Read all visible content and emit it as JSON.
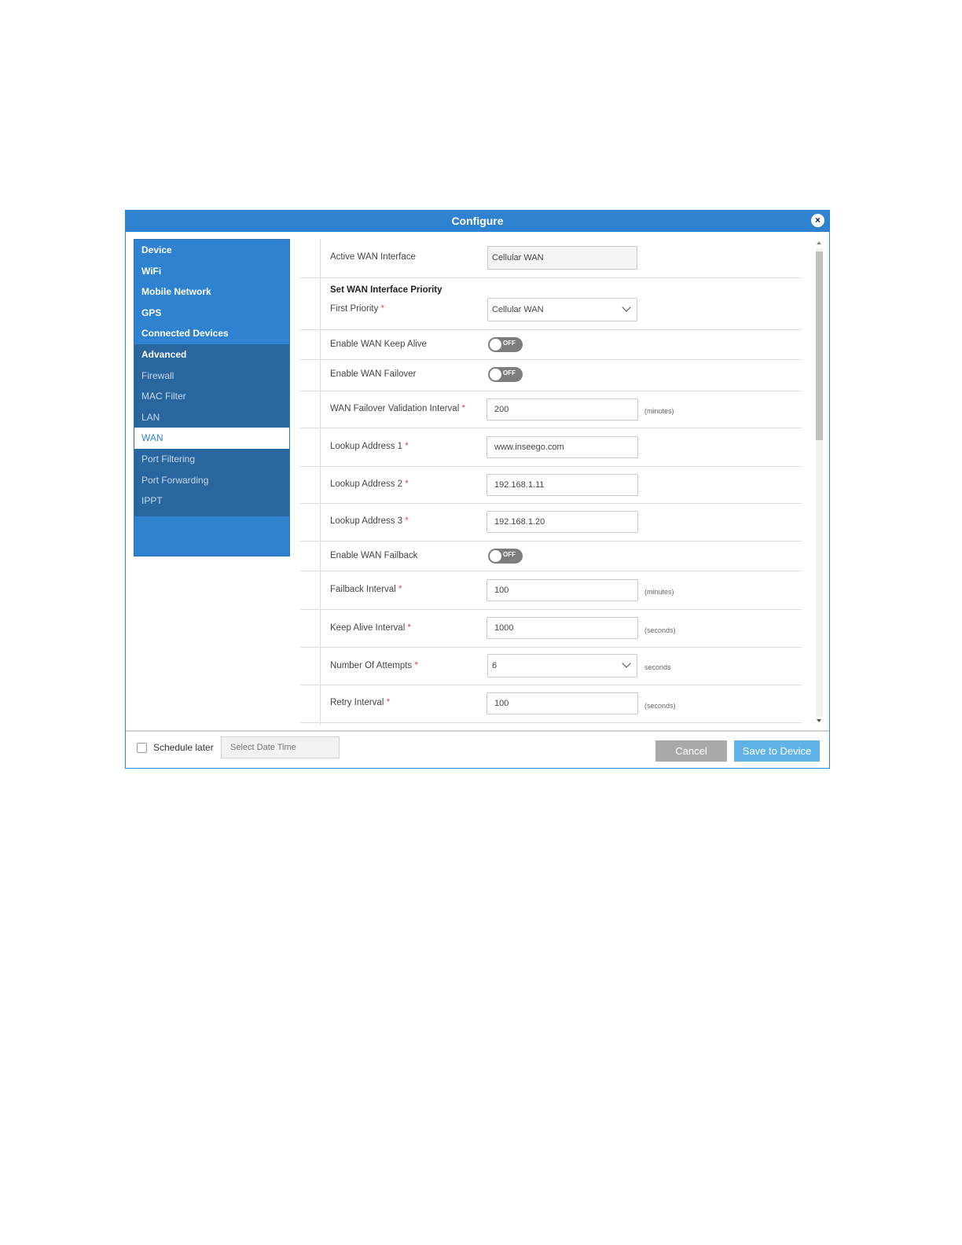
{
  "dialog": {
    "title": "Configure",
    "close_icon": "×"
  },
  "sidebar": {
    "items": [
      {
        "label": "Device"
      },
      {
        "label": "WiFi"
      },
      {
        "label": "Mobile Network"
      },
      {
        "label": "GPS"
      },
      {
        "label": "Connected Devices"
      },
      {
        "label": "Advanced"
      },
      {
        "label": "Firewall"
      },
      {
        "label": "MAC Filter"
      },
      {
        "label": "LAN"
      },
      {
        "label": "WAN",
        "selected": true
      },
      {
        "label": "Port Filtering"
      },
      {
        "label": "Port Forwarding"
      },
      {
        "label": "IPPT"
      }
    ]
  },
  "form": {
    "active_wan": {
      "label": "Active WAN Interface",
      "value": "Cellular WAN"
    },
    "priority": {
      "section": "Set WAN Interface Priority",
      "label": "First Priority",
      "value": "Cellular WAN"
    },
    "keep_alive": {
      "label": "Enable WAN Keep Alive",
      "state": "OFF"
    },
    "failover": {
      "label": "Enable WAN Failover",
      "state": "OFF"
    },
    "failover_interval": {
      "label": "WAN Failover Validation Interval",
      "value": "200",
      "unit": "(minutes)"
    },
    "lookup1": {
      "label": "Lookup Address 1",
      "value": "www.inseego.com"
    },
    "lookup2": {
      "label": "Lookup Address 2",
      "value": "192.168.1.11"
    },
    "lookup3": {
      "label": "Lookup Address 3",
      "value": "192.168.1.20"
    },
    "failback": {
      "label": "Enable WAN Failback",
      "state": "OFF"
    },
    "failback_interval": {
      "label": "Failback Interval",
      "value": "100",
      "unit": "(minutes)"
    },
    "keep_alive_interval": {
      "label": "Keep Alive Interval",
      "value": "1000",
      "unit": "(seconds)"
    },
    "attempts": {
      "label": "Number Of Attempts",
      "value": "6",
      "unit": "seconds"
    },
    "retry_interval": {
      "label": "Retry Interval",
      "value": "100",
      "unit": "(seconds)"
    },
    "required_mark": "*"
  },
  "footer": {
    "schedule_label": "Schedule later",
    "date_placeholder": "Select Date Time",
    "cancel_label": "Cancel",
    "save_label": "Save to Device"
  },
  "colors": {
    "accent": "#2f82cf",
    "sidebar_dark": "#2866a0",
    "required": "#e04a4a",
    "save_button": "#5fb3e8",
    "cancel_button": "#a9a9a9"
  }
}
